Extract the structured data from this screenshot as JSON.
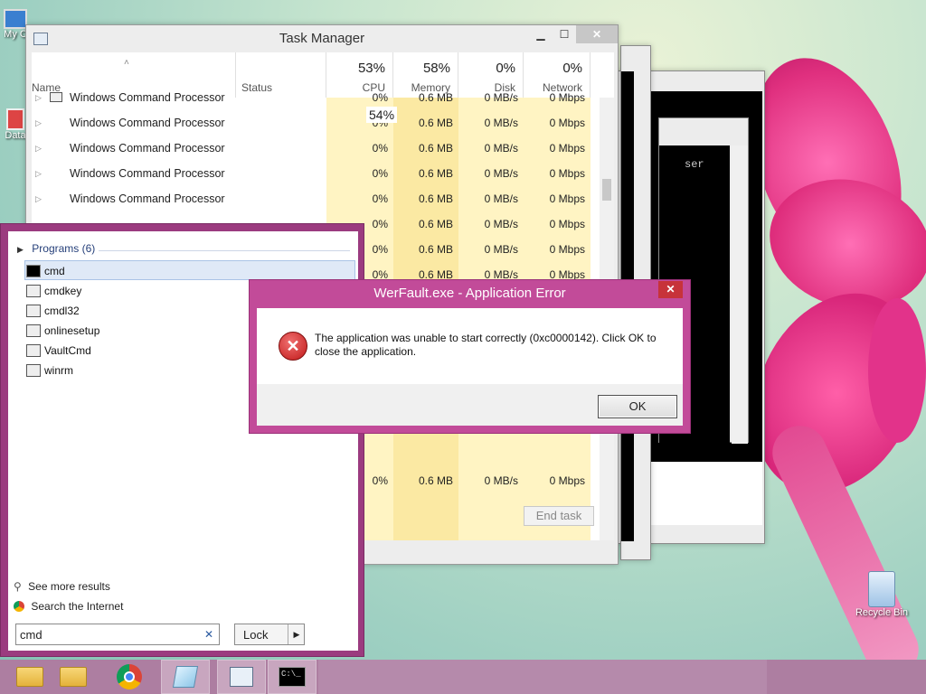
{
  "desktop": {
    "icons": [
      {
        "label": "My C",
        "icon": "computer-icon"
      },
      {
        "label": "Data",
        "icon": "network-icon"
      }
    ],
    "recycle_bin": {
      "label": "Recycle Bin",
      "icon": "recycle-bin-icon"
    }
  },
  "task_manager": {
    "title": "Task Manager",
    "controls": {
      "minimize": "▁",
      "maximize": "☐",
      "close": "✕"
    },
    "columns": {
      "name": "Name",
      "status": "Status",
      "cpu": {
        "pct": "53%",
        "label": "CPU"
      },
      "memory": {
        "pct": "58%",
        "label": "Memory"
      },
      "disk": {
        "pct": "0%",
        "label": "Disk"
      },
      "network": {
        "pct": "0%",
        "label": "Network"
      }
    },
    "cpu_tooltip": "54%",
    "rows": [
      {
        "name": "Windows Command Processor",
        "cpu": "0%",
        "memory": "0.6 MB",
        "disk": "0 MB/s",
        "network": "0 Mbps"
      },
      {
        "name": "Windows Command Processor",
        "cpu": "0%",
        "memory": "0.6 MB",
        "disk": "0 MB/s",
        "network": "0 Mbps"
      },
      {
        "name": "Windows Command Processor",
        "cpu": "0%",
        "memory": "0.6 MB",
        "disk": "0 MB/s",
        "network": "0 Mbps"
      },
      {
        "name": "Windows Command Processor",
        "cpu": "0%",
        "memory": "0.6 MB",
        "disk": "0 MB/s",
        "network": "0 Mbps"
      },
      {
        "name": "Windows Command Processor",
        "cpu": "0%",
        "memory": "0.6 MB",
        "disk": "0 MB/s",
        "network": "0 Mbps"
      },
      {
        "name": "",
        "cpu": "0%",
        "memory": "0.6 MB",
        "disk": "0 MB/s",
        "network": "0 Mbps"
      },
      {
        "name": "",
        "cpu": "0%",
        "memory": "0.6 MB",
        "disk": "0 MB/s",
        "network": "0 Mbps"
      },
      {
        "name": "",
        "cpu": "0%",
        "memory": "0.6 MB",
        "disk": "0 MB/s",
        "network": "0 Mbps"
      }
    ],
    "last_row": {
      "cpu": "0%",
      "memory": "0.6 MB",
      "disk": "0 MB/s",
      "network": "0 Mbps"
    },
    "end_task": "End task"
  },
  "cmd_window": {
    "text": "ser"
  },
  "search": {
    "group": "Programs (6)",
    "results": [
      {
        "label": "cmd",
        "icon": "cmd-icon"
      },
      {
        "label": "cmdkey",
        "icon": "app-icon"
      },
      {
        "label": "cmdl32",
        "icon": "phone-book-icon"
      },
      {
        "label": "onlinesetup",
        "icon": "app-icon"
      },
      {
        "label": "VaultCmd",
        "icon": "app-icon"
      },
      {
        "label": "winrm",
        "icon": "app-icon"
      }
    ],
    "see_more": "See more results",
    "search_internet": "Search the Internet",
    "query": "cmd",
    "clear": "✕",
    "lock": "Lock",
    "lock_arrow": "▶"
  },
  "error_dialog": {
    "title": "WerFault.exe - Application Error",
    "close": "✕",
    "message": "The application was unable to start correctly (0xc0000142). Click OK to close the application.",
    "ok": "OK"
  },
  "taskbar": {
    "items": [
      {
        "icon": "folder-icon"
      },
      {
        "icon": "folder-icon"
      },
      {
        "icon": "chrome-icon"
      },
      {
        "icon": "notepad-icon"
      },
      {
        "icon": "task-manager-icon"
      },
      {
        "icon": "cmd-icon"
      }
    ],
    "cmd_glyph": "C:\\_"
  }
}
